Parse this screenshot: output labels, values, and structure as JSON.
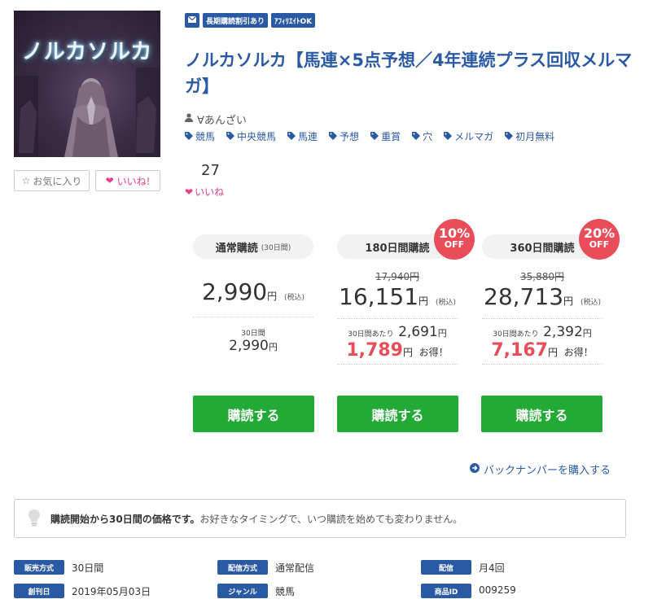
{
  "cover": {
    "title": "ノルカソルカ"
  },
  "actions": {
    "favorite_label": "お気に入り",
    "like_button_label": "いいね!"
  },
  "likes": {
    "count": "27",
    "label": "いいね"
  },
  "badges": {
    "long_term_discount": "長期購読割引あり",
    "affiliate": "ｱﾌｨﾘｴｲﾄOK"
  },
  "title": "ノルカソルカ【馬連×5点予想／4年連続プラス回収メルマガ】",
  "author": "∀あんざい",
  "tags": [
    "競馬",
    "中央競馬",
    "馬連",
    "予想",
    "重賞",
    "穴",
    "メルマガ",
    "初月無料"
  ],
  "plans": [
    {
      "name": "通常購読",
      "period": "(30日間)",
      "price": "2,990",
      "yen": "円",
      "tax": "(税込)",
      "per_label": "30日間",
      "per_price": "2,990",
      "buy_label": "購読する"
    },
    {
      "name": "180日間購読",
      "off": "10%",
      "off_word": "OFF",
      "old_price": "17,940円",
      "price": "16,151",
      "yen": "円",
      "tax": "(税込)",
      "per_label": "30日間あたり",
      "per_price": "2,691",
      "saving": "1,789",
      "saving_suffix": "お得！",
      "buy_label": "購読する"
    },
    {
      "name": "360日間購読",
      "off": "20%",
      "off_word": "OFF",
      "old_price": "35,880円",
      "price": "28,713",
      "yen": "円",
      "tax": "(税込)",
      "per_label": "30日間あたり",
      "per_price": "2,392",
      "saving": "7,167",
      "saving_suffix": "お得！",
      "buy_label": "購読する"
    }
  ],
  "back_number_link": "バックナンバーを購入する",
  "notice": {
    "bold": "購読開始から30日間の価格です。",
    "text": "お好きなタイミングで、いつ購読を始めても変わりません。"
  },
  "meta": [
    {
      "label": "販売方式",
      "value": "30日間"
    },
    {
      "label": "配信方式",
      "value": "通常配信"
    },
    {
      "label": "配信",
      "value": "月4回"
    },
    {
      "label": "創刊日",
      "value": "2019年05月03日"
    },
    {
      "label": "ジャンル",
      "value": "競馬"
    },
    {
      "label": "商品ID",
      "value": "009259"
    }
  ],
  "colors": {
    "brand_blue": "#2b5aa5",
    "buy_green": "#22a936",
    "sale_red": "#e84e5a",
    "like_pink": "#e83e8c"
  },
  "icons": [
    "mail-icon",
    "user-icon",
    "tag-icon",
    "heart-icon",
    "star-icon",
    "arrow-circle-right-icon",
    "lightbulb-icon"
  ]
}
